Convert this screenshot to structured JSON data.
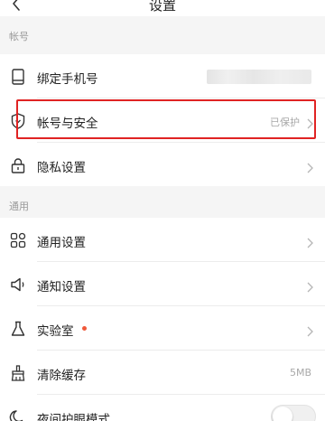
{
  "header": {
    "title": "设置"
  },
  "sections": [
    {
      "label": "帐号"
    },
    {
      "label": "通用"
    }
  ],
  "account": {
    "bind_phone": {
      "label": "绑定手机号"
    },
    "security": {
      "label": "帐号与安全",
      "value": "已保护"
    },
    "privacy": {
      "label": "隐私设置"
    }
  },
  "general": {
    "general_settings": {
      "label": "通用设置"
    },
    "notifications": {
      "label": "通知设置"
    },
    "lab": {
      "label": "实验室"
    },
    "clear_cache": {
      "label": "清除缓存",
      "value": "5MB"
    },
    "night_mode": {
      "label": "夜间护眼模式",
      "enabled": false
    }
  },
  "colors": {
    "highlight": "#e02323",
    "badge_dot": "#f0593a"
  },
  "icons": {
    "back": "chevron-left-icon",
    "bind_phone": "phone-icon",
    "security": "shield-icon",
    "privacy": "lock-icon",
    "general_settings": "grid-icon",
    "notifications": "speaker-icon",
    "lab": "flask-icon",
    "clear_cache": "broom-icon",
    "night_mode": "moon-icon"
  }
}
